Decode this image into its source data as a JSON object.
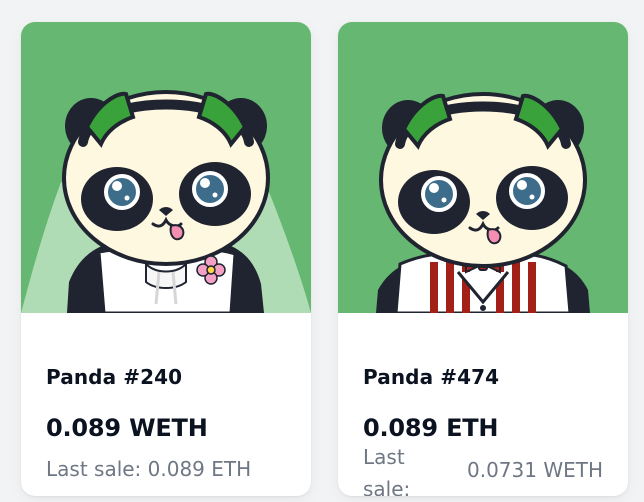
{
  "cards": [
    {
      "name": "Panda #240",
      "price": "0.089 WETH",
      "last_sale": "Last sale: 0.089 ETH",
      "colors": {
        "background": "#66b772",
        "headphones": "#2f9e2f",
        "accessory": "#e77bb0"
      }
    },
    {
      "name": "Panda #474",
      "price": "0.089 ETH",
      "last_sale_label": "Last sale:",
      "last_sale_value": "0.0731 WETH",
      "colors": {
        "background": "#66b772",
        "headphones": "#2f9e2f",
        "stripes": "#a32018",
        "bowtie": "#b32618"
      }
    }
  ]
}
